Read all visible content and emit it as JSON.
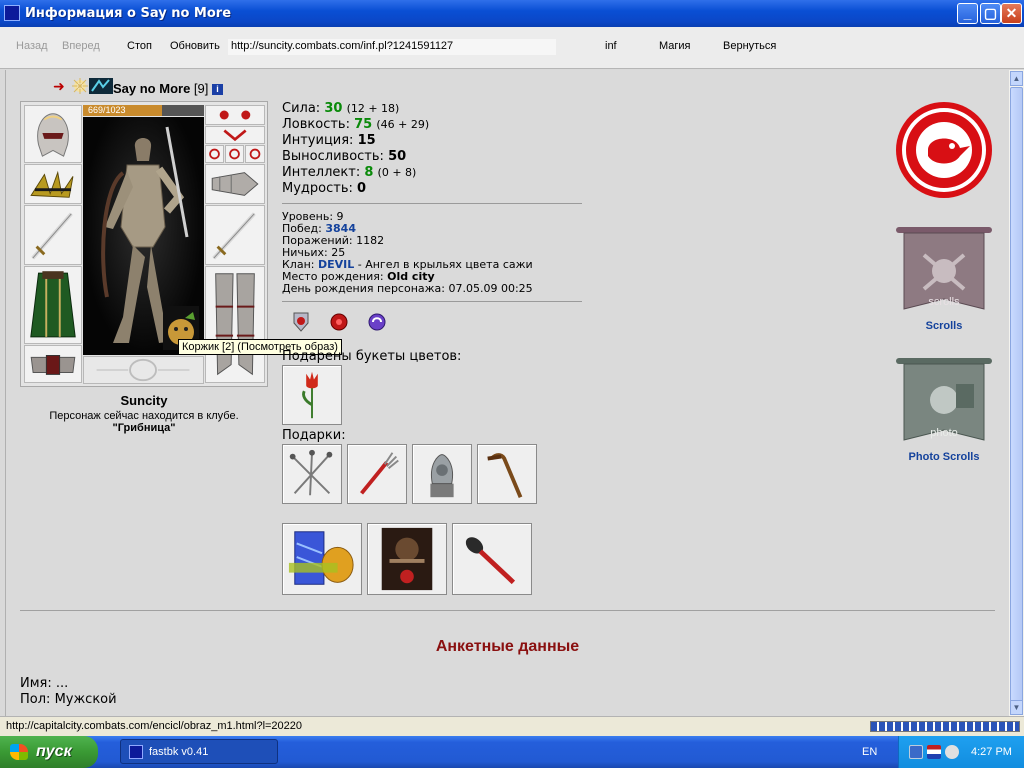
{
  "window": {
    "title": "Информация о Say no More",
    "min_label": "_",
    "max_label": "▢",
    "close_label": "✕"
  },
  "toolbar": {
    "back_label": "Назад",
    "forward_label": "Вперед",
    "stop_label": "Стоп",
    "refresh_label": "Обновить",
    "url": "http://suncity.combats.com/inf.pl?1241591127",
    "inf_label": "inf",
    "magic_label": "Магия",
    "return_label": "Вернуться"
  },
  "character": {
    "nick": "Say no More",
    "level": "[9]",
    "info_glyph": "i",
    "hp_text": "669/1023",
    "hp_fraction": 0.654,
    "tooltip": "Коржик [2] (Посмотреть образ)",
    "city": "Suncity",
    "club_text": "Персонаж сейчас находится в клубе.",
    "club_place": "\"Грибница\""
  },
  "stats": [
    {
      "label": "Сила:",
      "value": "30",
      "extra": "(12 + 18)",
      "green": true
    },
    {
      "label": "Ловкость:",
      "value": "75",
      "extra": "(46 + 29)",
      "green": true
    },
    {
      "label": "Интуиция:",
      "value": "15",
      "extra": "",
      "green": false
    },
    {
      "label": "Выносливость:",
      "value": "50",
      "extra": "",
      "green": false
    },
    {
      "label": "Интеллект:",
      "value": "8",
      "extra": "(0 + 8)",
      "green": true
    },
    {
      "label": "Мудрость:",
      "value": "0",
      "extra": "",
      "green": false
    }
  ],
  "info": {
    "level_label": "Уровень:",
    "level_value": "9",
    "wins_label": "Побед:",
    "wins_value": "3844",
    "losses_label": "Поражений:",
    "losses_value": "1182",
    "draws_label": "Ничьих:",
    "draws_value": "25",
    "clan_label": "Клан:",
    "clan_name": "DEVIL",
    "clan_rank": "- Ангел в крыльях цвета сажи",
    "birthplace_label": "Место рождения:",
    "birthplace_value": "Old city",
    "birthday_label": "День рождения персонажа:",
    "birthday_value": "07.05.09 00:25"
  },
  "flowers_label": "Подарены букеты цветов:",
  "gifts_label": "Подарки:",
  "sidebar": {
    "scrolls_label": "Scrolls",
    "scrolls_banner_text": "scrolls",
    "photo_label": "Photo Scrolls",
    "photo_banner_text": "photo"
  },
  "profile": {
    "title": "Анкетные данные",
    "name_label": "Имя:",
    "name_value": "...",
    "gender_label": "Пол:",
    "gender_value": "Мужской"
  },
  "status": {
    "url": "http://capitalcity.combats.com/encicl/obraz_m1.html?l=20220"
  },
  "taskbar": {
    "start_label": "пуск",
    "task_label": "fastbk v0.41",
    "lang": "EN",
    "clock": "4:27 PM"
  }
}
